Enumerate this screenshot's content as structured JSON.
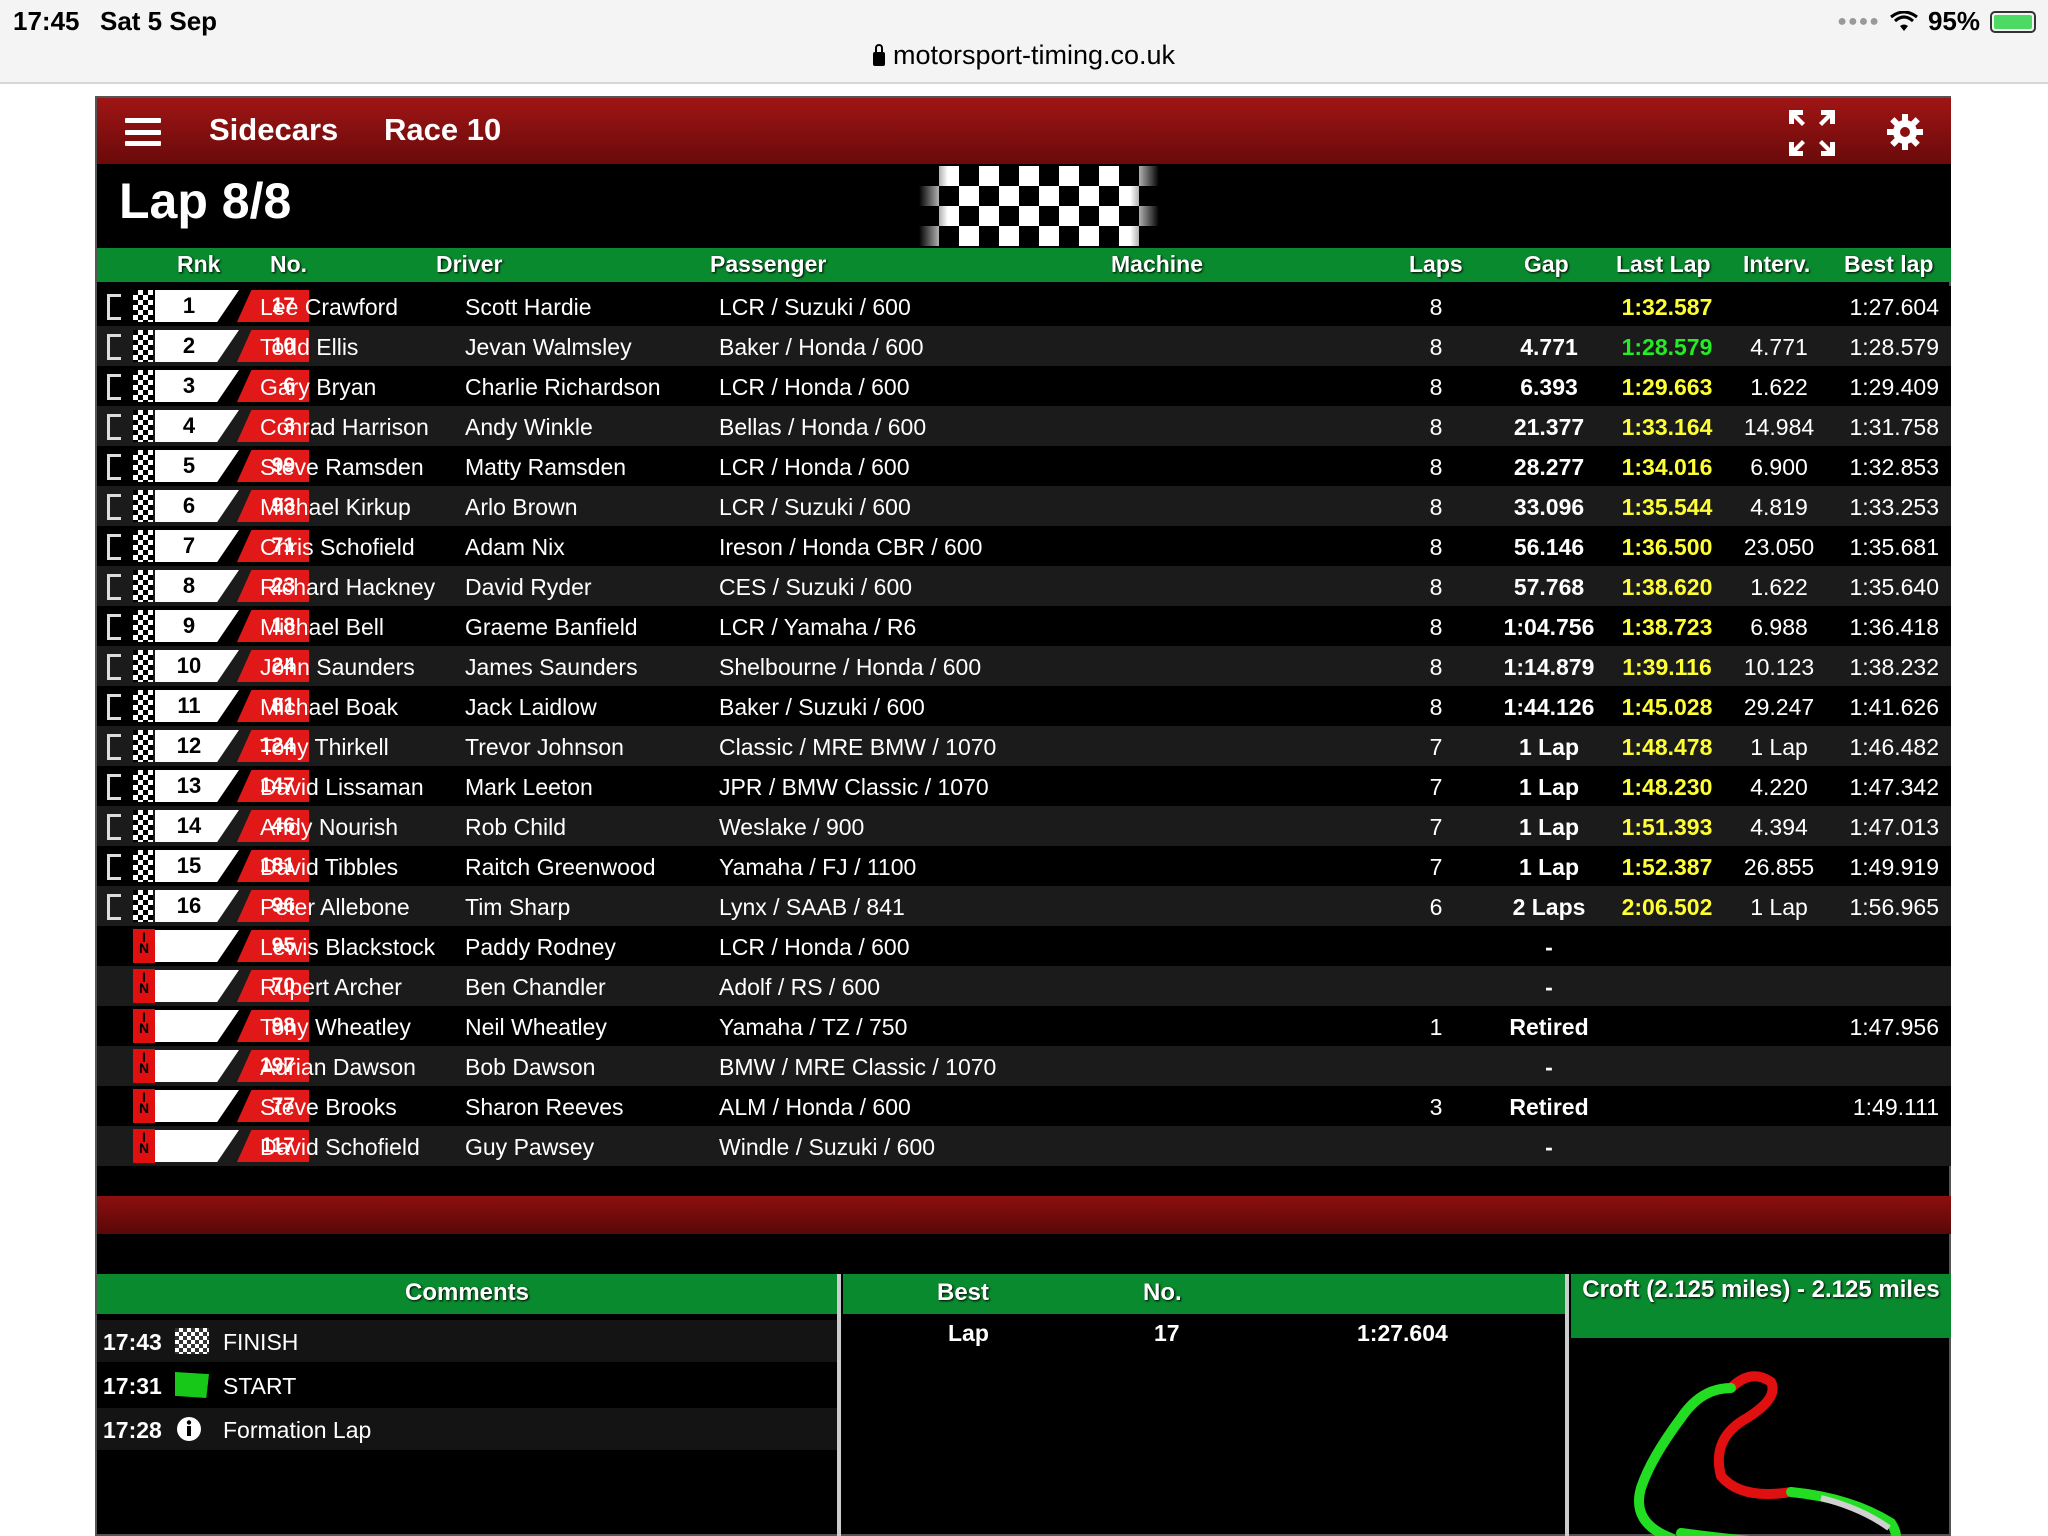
{
  "status": {
    "time": "17:45",
    "date": "Sat 5 Sep",
    "battery": "95%"
  },
  "browser": {
    "url": "motorsport-timing.co.uk"
  },
  "header": {
    "series": "Sidecars",
    "race": "Race 10"
  },
  "lap_title": "Lap 8/8",
  "columns": {
    "rank": "Rnk",
    "no": "No.",
    "driver": "Driver",
    "passenger": "Passenger",
    "machine": "Machine",
    "laps": "Laps",
    "gap": "Gap",
    "last_lap": "Last Lap",
    "interval": "Interv.",
    "best_lap": "Best lap"
  },
  "results": [
    {
      "rank": "1",
      "no": "17",
      "driver": "Lee Crawford",
      "passenger": "Scott Hardie",
      "machine": "LCR / Suzuki / 600",
      "laps": "8",
      "gap": "",
      "last_lap": "1:32.587",
      "last_lap_color": "yellow",
      "interval": "",
      "best_lap": "1:27.604",
      "status": "finished"
    },
    {
      "rank": "2",
      "no": "10",
      "driver": "Todd Ellis",
      "passenger": "Jevan Walmsley",
      "machine": "Baker / Honda / 600",
      "laps": "8",
      "gap": "4.771",
      "last_lap": "1:28.579",
      "last_lap_color": "green",
      "interval": "4.771",
      "best_lap": "1:28.579",
      "status": "finished"
    },
    {
      "rank": "3",
      "no": "6",
      "driver": "Gary Bryan",
      "passenger": "Charlie Richardson",
      "machine": "LCR / Honda / 600",
      "laps": "8",
      "gap": "6.393",
      "last_lap": "1:29.663",
      "last_lap_color": "yellow",
      "interval": "1.622",
      "best_lap": "1:29.409",
      "status": "finished"
    },
    {
      "rank": "4",
      "no": "3",
      "driver": "Conrad Harrison",
      "passenger": "Andy Winkle",
      "machine": "Bellas / Honda / 600",
      "laps": "8",
      "gap": "21.377",
      "last_lap": "1:33.164",
      "last_lap_color": "yellow",
      "interval": "14.984",
      "best_lap": "1:31.758",
      "status": "finished"
    },
    {
      "rank": "5",
      "no": "99",
      "driver": "Steve Ramsden",
      "passenger": "Matty Ramsden",
      "machine": "LCR / Honda / 600",
      "laps": "8",
      "gap": "28.277",
      "last_lap": "1:34.016",
      "last_lap_color": "yellow",
      "interval": "6.900",
      "best_lap": "1:32.853",
      "status": "finished"
    },
    {
      "rank": "6",
      "no": "93",
      "driver": "Michael Kirkup",
      "passenger": "Arlo Brown",
      "machine": "LCR / Suzuki / 600",
      "laps": "8",
      "gap": "33.096",
      "last_lap": "1:35.544",
      "last_lap_color": "yellow",
      "interval": "4.819",
      "best_lap": "1:33.253",
      "status": "finished"
    },
    {
      "rank": "7",
      "no": "71",
      "driver": "Chris Schofield",
      "passenger": "Adam Nix",
      "machine": "Ireson / Honda CBR / 600",
      "laps": "8",
      "gap": "56.146",
      "last_lap": "1:36.500",
      "last_lap_color": "yellow",
      "interval": "23.050",
      "best_lap": "1:35.681",
      "status": "finished"
    },
    {
      "rank": "8",
      "no": "23",
      "driver": "Richard Hackney",
      "passenger": "David Ryder",
      "machine": "CES / Suzuki / 600",
      "laps": "8",
      "gap": "57.768",
      "last_lap": "1:38.620",
      "last_lap_color": "yellow",
      "interval": "1.622",
      "best_lap": "1:35.640",
      "status": "finished"
    },
    {
      "rank": "9",
      "no": "18",
      "driver": "Michael Bell",
      "passenger": "Graeme Banfield",
      "machine": "LCR / Yamaha / R6",
      "laps": "8",
      "gap": "1:04.756",
      "last_lap": "1:38.723",
      "last_lap_color": "yellow",
      "interval": "6.988",
      "best_lap": "1:36.418",
      "status": "finished"
    },
    {
      "rank": "10",
      "no": "24",
      "driver": "John Saunders",
      "passenger": "James Saunders",
      "machine": "Shelbourne / Honda / 600",
      "laps": "8",
      "gap": "1:14.879",
      "last_lap": "1:39.116",
      "last_lap_color": "yellow",
      "interval": "10.123",
      "best_lap": "1:38.232",
      "status": "finished"
    },
    {
      "rank": "11",
      "no": "81",
      "driver": "Michael Boak",
      "passenger": "Jack Laidlow",
      "machine": "Baker / Suzuki / 600",
      "laps": "8",
      "gap": "1:44.126",
      "last_lap": "1:45.028",
      "last_lap_color": "yellow",
      "interval": "29.247",
      "best_lap": "1:41.626",
      "status": "finished"
    },
    {
      "rank": "12",
      "no": "124",
      "driver": "Tony Thirkell",
      "passenger": "Trevor Johnson",
      "machine": "Classic / MRE BMW / 1070",
      "laps": "7",
      "gap": "1 Lap",
      "last_lap": "1:48.478",
      "last_lap_color": "yellow",
      "interval": "1 Lap",
      "best_lap": "1:46.482",
      "status": "finished"
    },
    {
      "rank": "13",
      "no": "147",
      "driver": "David Lissaman",
      "passenger": "Mark Leeton",
      "machine": "JPR / BMW Classic / 1070",
      "laps": "7",
      "gap": "1 Lap",
      "last_lap": "1:48.230",
      "last_lap_color": "yellow",
      "interval": "4.220",
      "best_lap": "1:47.342",
      "status": "finished"
    },
    {
      "rank": "14",
      "no": "46",
      "driver": "Andy Nourish",
      "passenger": "Rob Child",
      "machine": "Weslake / 900",
      "laps": "7",
      "gap": "1 Lap",
      "last_lap": "1:51.393",
      "last_lap_color": "yellow",
      "interval": "4.394",
      "best_lap": "1:47.013",
      "status": "finished"
    },
    {
      "rank": "15",
      "no": "181",
      "driver": "David Tibbles",
      "passenger": "Raitch Greenwood",
      "machine": "Yamaha / FJ / 1100",
      "laps": "7",
      "gap": "1 Lap",
      "last_lap": "1:52.387",
      "last_lap_color": "yellow",
      "interval": "26.855",
      "best_lap": "1:49.919",
      "status": "finished"
    },
    {
      "rank": "16",
      "no": "96",
      "driver": "Peter Allebone",
      "passenger": "Tim Sharp",
      "machine": "Lynx / SAAB / 841",
      "laps": "6",
      "gap": "2 Laps",
      "last_lap": "2:06.502",
      "last_lap_color": "yellow",
      "interval": "1 Lap",
      "best_lap": "1:56.965",
      "status": "finished"
    },
    {
      "rank": "",
      "no": "95",
      "driver": "Lewis Blackstock",
      "passenger": "Paddy Rodney",
      "machine": "LCR / Honda / 600",
      "laps": "",
      "gap": "-",
      "last_lap": "",
      "last_lap_color": "yellow",
      "interval": "",
      "best_lap": "",
      "status": "in"
    },
    {
      "rank": "",
      "no": "70",
      "driver": "Rupert Archer",
      "passenger": "Ben Chandler",
      "machine": "Adolf / RS / 600",
      "laps": "",
      "gap": "-",
      "last_lap": "",
      "last_lap_color": "yellow",
      "interval": "",
      "best_lap": "",
      "status": "in"
    },
    {
      "rank": "",
      "no": "98",
      "driver": "Tony Wheatley",
      "passenger": "Neil Wheatley",
      "machine": "Yamaha / TZ / 750",
      "laps": "1",
      "gap": "Retired",
      "last_lap": "",
      "last_lap_color": "yellow",
      "interval": "",
      "best_lap": "1:47.956",
      "status": "in"
    },
    {
      "rank": "",
      "no": "197",
      "driver": "Adrian Dawson",
      "passenger": "Bob Dawson",
      "machine": "BMW / MRE Classic / 1070",
      "laps": "",
      "gap": "-",
      "last_lap": "",
      "last_lap_color": "yellow",
      "interval": "",
      "best_lap": "",
      "status": "in"
    },
    {
      "rank": "",
      "no": "77",
      "driver": "Steve Brooks",
      "passenger": "Sharon Reeves",
      "machine": "ALM / Honda / 600",
      "laps": "3",
      "gap": "Retired",
      "last_lap": "",
      "last_lap_color": "yellow",
      "interval": "",
      "best_lap": "1:49.111",
      "status": "in"
    },
    {
      "rank": "",
      "no": "117",
      "driver": "David Schofield",
      "passenger": "Guy Pawsey",
      "machine": "Windle / Suzuki / 600",
      "laps": "",
      "gap": "-",
      "last_lap": "",
      "last_lap_color": "yellow",
      "interval": "",
      "best_lap": "",
      "status": "in"
    }
  ],
  "in_label": "IN",
  "comments": {
    "title": "Comments",
    "items": [
      {
        "time": "17:43",
        "icon": "checkered-flag-icon",
        "text": "FINISH"
      },
      {
        "time": "17:31",
        "icon": "green-flag-icon",
        "text": "START"
      },
      {
        "time": "17:28",
        "icon": "info-icon",
        "text": "Formation Lap"
      }
    ]
  },
  "best": {
    "header_best": "Best",
    "header_no": "No.",
    "label": "Lap",
    "no": "17",
    "time": "1:27.604"
  },
  "track": {
    "title": "Croft (2.125 miles) - 2.125 miles"
  },
  "colors": {
    "header_red": "#a01515",
    "table_green": "#0a8a2e",
    "number_red": "#e01818",
    "last_lap_yellow": "#ffff33",
    "best_lap_green": "#22ee22"
  }
}
